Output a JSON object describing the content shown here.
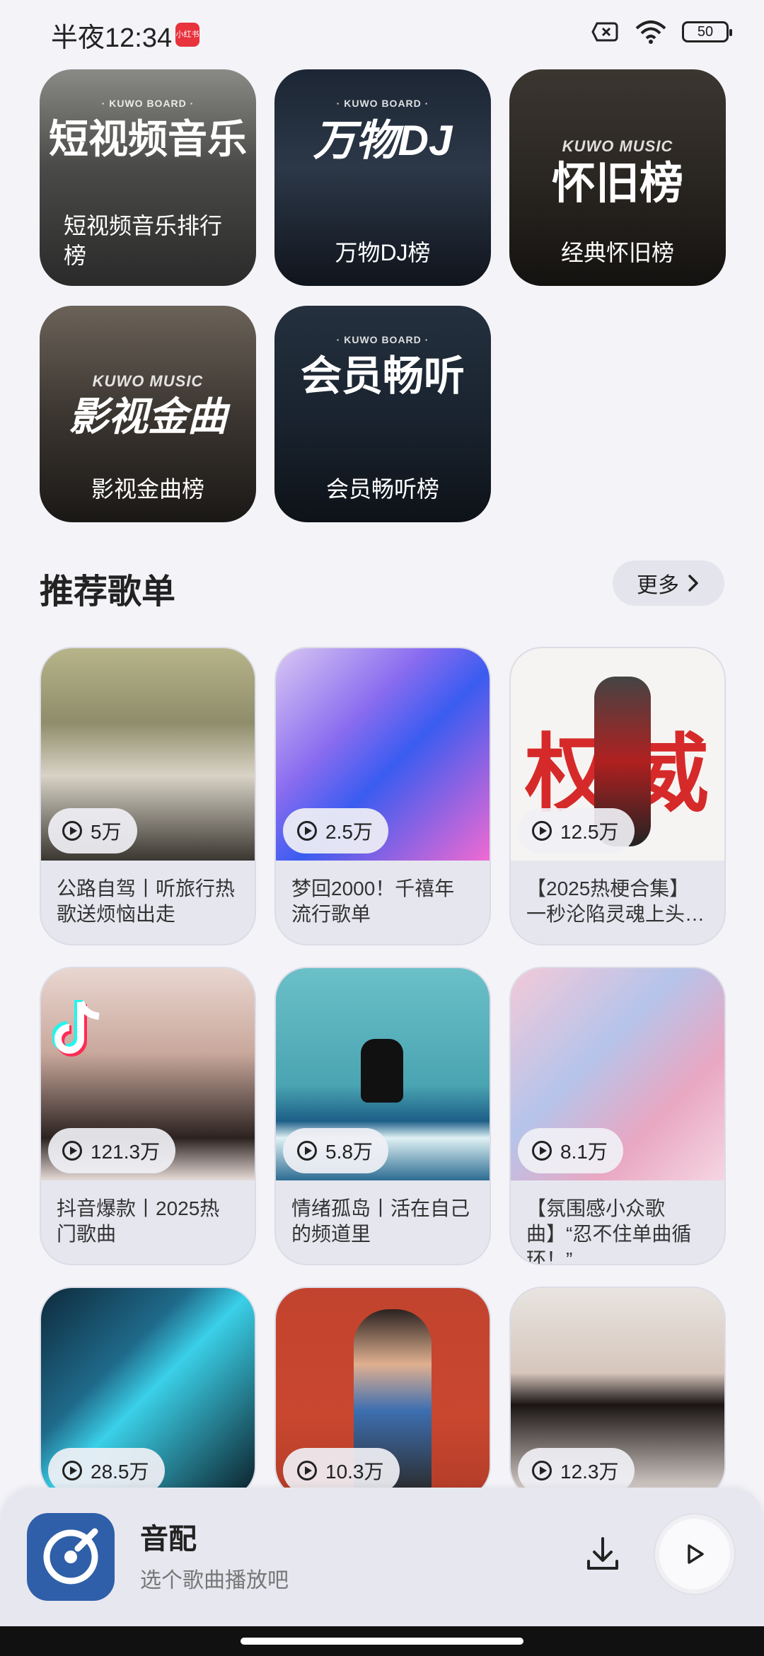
{
  "status": {
    "time": "半夜12:34",
    "badge": "小红书",
    "battery": "50"
  },
  "rankings": [
    {
      "brand": "· KUWO BOARD ·",
      "big": "短视频音乐",
      "label": "短视频音乐排行榜"
    },
    {
      "brand": "· KUWO BOARD ·",
      "big": "万物DJ",
      "label": "万物DJ榜"
    },
    {
      "brand": "KUWO MUSIC",
      "big": "怀旧榜",
      "label": "经典怀旧榜"
    },
    {
      "brand": "KUWO MUSIC",
      "big": "影视金曲",
      "label": "影视金曲榜"
    },
    {
      "brand": "· KUWO BOARD ·",
      "big": "会员畅听",
      "label": "会员畅听榜"
    }
  ],
  "section": {
    "title": "推荐歌单",
    "more": "更多"
  },
  "playlists": [
    {
      "count": "5万",
      "title": "公路自驾丨听旅行热歌送烦恼出走"
    },
    {
      "count": "2.5万",
      "title": "梦回2000！千禧年流行歌单"
    },
    {
      "count": "12.5万",
      "title": "【2025热梗合集】一秒沦陷灵魂上头…",
      "cover_text": "权威"
    },
    {
      "count": "121.3万",
      "title": "抖音爆款丨2025热门歌曲"
    },
    {
      "count": "5.8万",
      "title": "情绪孤岛丨活在自己的频道里"
    },
    {
      "count": "8.1万",
      "title": "【氛围感小众歌曲】“忍不住单曲循环！”"
    },
    {
      "count": "28.5万",
      "title": ""
    },
    {
      "count": "10.3万",
      "title": ""
    },
    {
      "count": "12.3万",
      "title": ""
    }
  ],
  "player": {
    "title": "音配",
    "subtitle": "选个歌曲播放吧"
  }
}
